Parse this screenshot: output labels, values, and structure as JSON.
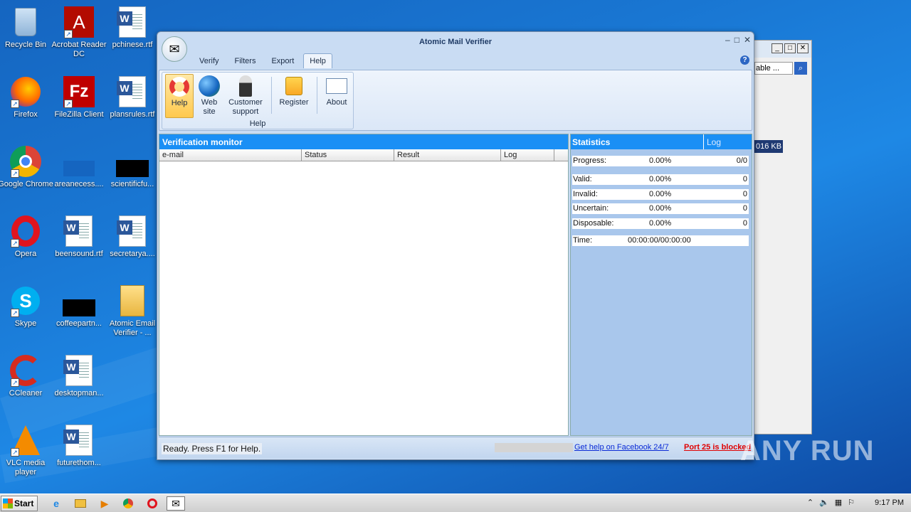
{
  "desktop": {
    "icons": [
      {
        "label": "Recycle Bin",
        "glyph": "🗑"
      },
      {
        "label": "Acrobat Reader DC",
        "glyph": "A"
      },
      {
        "label": "pchinese.rtf",
        "glyph": "W"
      },
      {
        "label": "Firefox",
        "glyph": "🦊"
      },
      {
        "label": "FileZilla Client",
        "glyph": "Fz"
      },
      {
        "label": "plansrules.rtf",
        "glyph": "W"
      },
      {
        "label": "Google Chrome",
        "glyph": "◉"
      },
      {
        "label": "areanecess....",
        "glyph": ""
      },
      {
        "label": "scientificfu...",
        "glyph": ""
      },
      {
        "label": "Opera",
        "glyph": "O"
      },
      {
        "label": "beensound.rtf",
        "glyph": "W"
      },
      {
        "label": "secretarya....",
        "glyph": "W"
      },
      {
        "label": "Skype",
        "glyph": "S"
      },
      {
        "label": "coffeepartn...",
        "glyph": ""
      },
      {
        "label": "Atomic Email Verifier - ...",
        "glyph": "📁"
      },
      {
        "label": "CCleaner",
        "glyph": "C"
      },
      {
        "label": "desktopman...",
        "glyph": "W"
      },
      {
        "label": "VLC media player",
        "glyph": "▲"
      },
      {
        "label": "futurethom...",
        "glyph": "W"
      }
    ]
  },
  "bgwindow": {
    "search_text": "able ...",
    "size_text": "016 KB"
  },
  "window": {
    "title": "Atomic Mail Verifier",
    "tabs": [
      "Verify",
      "Filters",
      "Export",
      "Help"
    ],
    "ribbon": {
      "group_label": "Help",
      "buttons": {
        "help": "Help",
        "website": "Web site",
        "support": "Customer support",
        "register": "Register",
        "about": "About"
      }
    },
    "monitor": {
      "title": "Verification monitor",
      "columns": [
        "e-mail",
        "Status",
        "Result",
        "Log"
      ]
    },
    "stats": {
      "title": "Statistics",
      "log_tab": "Log",
      "progress": {
        "label": "Progress:",
        "pct": "0.00%",
        "count": "0/0"
      },
      "valid": {
        "label": "Valid:",
        "pct": "0.00%",
        "count": "0"
      },
      "invalid": {
        "label": "Invalid:",
        "pct": "0.00%",
        "count": "0"
      },
      "uncertain": {
        "label": "Uncertain:",
        "pct": "0.00%",
        "count": "0"
      },
      "disposable": {
        "label": "Disposable:",
        "pct": "0.00%",
        "count": "0"
      },
      "time": {
        "label": "Time:",
        "value": "00:00:00/00:00:00"
      }
    },
    "statusbar": {
      "text": "Ready. Press F1 for Help.",
      "facebook_link": "Get help on Facebook 24/7",
      "port_warning": "Port 25 is blocked"
    }
  },
  "taskbar": {
    "start_label": "Start",
    "clock": "9:17 PM"
  },
  "watermark": "ANY RUN"
}
